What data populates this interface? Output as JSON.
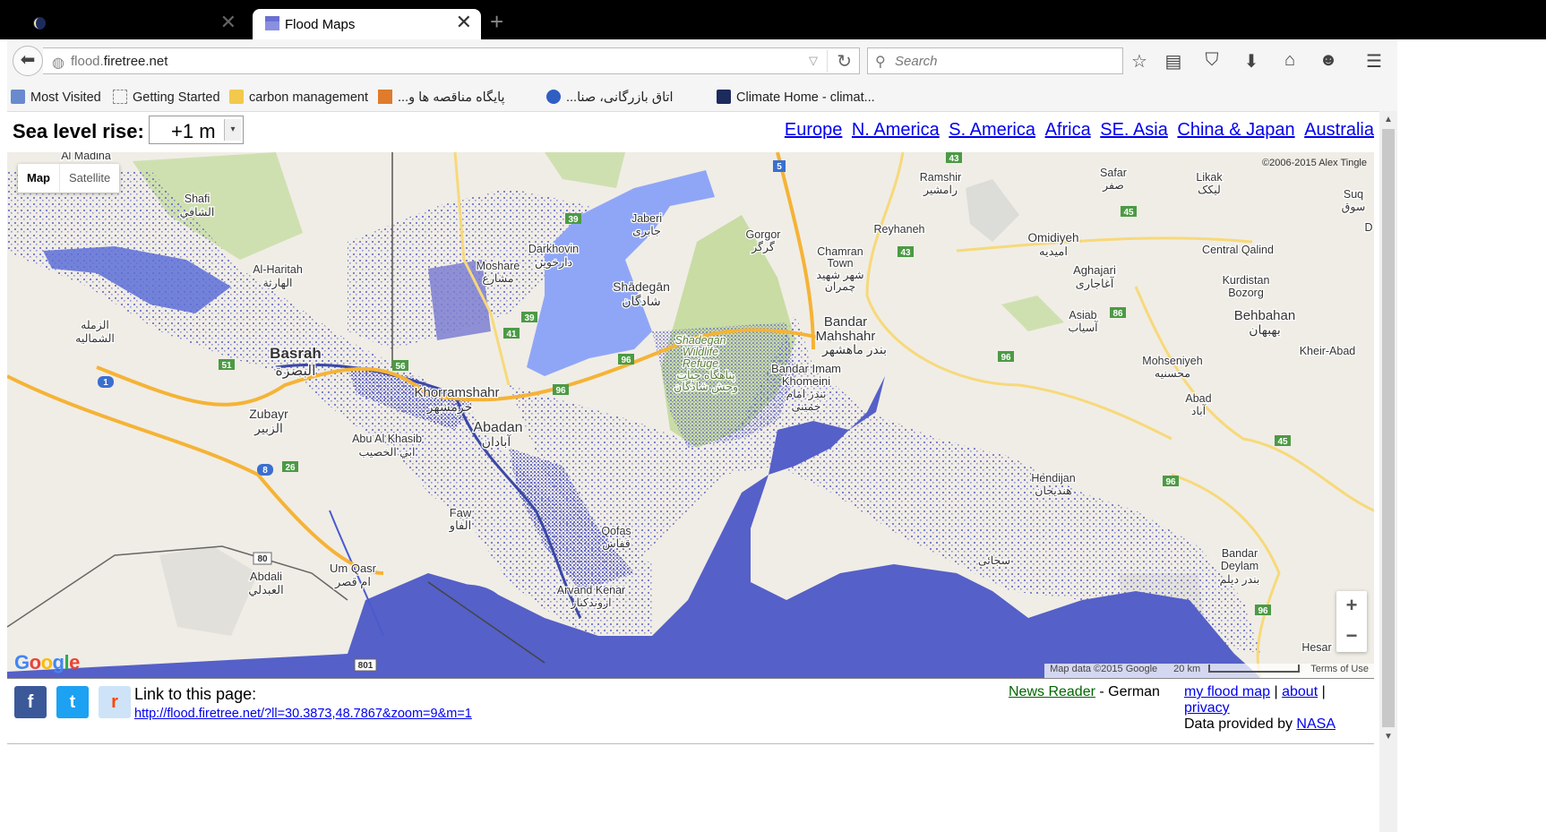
{
  "browser": {
    "tabs": [
      {
        "title": "",
        "active": false
      },
      {
        "title": "Flood Maps",
        "active": true
      }
    ],
    "url_host_prefix": "flood.",
    "url_host_main": "firetree.net",
    "search_placeholder": "Search",
    "bookmarks": [
      {
        "label": "Most Visited"
      },
      {
        "label": "Getting Started"
      },
      {
        "label": "carbon management"
      },
      {
        "label": "...پایگاه مناقصه ها و"
      },
      {
        "label": "...اتاق بازرگانی، صنا"
      },
      {
        "label": "Climate Home - climat..."
      }
    ]
  },
  "header": {
    "sea_level_label": "Sea level rise:",
    "sea_level_value": "+1 m",
    "regions": [
      "Europe",
      "N. America",
      "S. America",
      "Africa",
      "SE. Asia",
      "China & Japan",
      "Australia"
    ]
  },
  "map": {
    "type_buttons": {
      "map": "Map",
      "satellite": "Satellite"
    },
    "copyright": "©2006-2015 Alex Tingle",
    "map_data": "Map data ©2015 Google",
    "scale": "20 km",
    "terms": "Terms of Use",
    "google": "Google",
    "zoom_in": "+",
    "zoom_out": "−",
    "labels": {
      "al_madina": "Al Madina",
      "shafi": "Shafi",
      "shafi_ar": "الشافي",
      "al_haritah": "Al-Haritah",
      "al_haritah_ar": "الهارثة",
      "zubair_ar1": "الزمله",
      "zubair_ar2": "الشماليه",
      "basrah": "Basrah",
      "basrah_ar": "البصرة",
      "zubayr": "Zubayr",
      "zubayr_ar": "الزبير",
      "moshare": "Moshare",
      "moshare_ar": "مشارع",
      "darkhovin": "Darkhovin",
      "darkhovin_ar": "دارخوين",
      "jaberi": "Jaberi",
      "jaberi_ar": "جابری",
      "shadegan": "Shādegān",
      "shadegan_ar": "شادگان",
      "gorgor": "Gorgor",
      "gorgor_ar": "گرگر",
      "chamran": "Chamran",
      "chamran_town": "Town",
      "chamran_ar1": "شهر شهید",
      "chamran_ar2": "چمران",
      "reyhaneh": "Reyhaneh",
      "ramshir": "Ramshir",
      "ramshir_ar": "رامشیر",
      "bandar_mahshahr": "Bandar",
      "bandar_mahshahr2": "Mahshahr",
      "bandar_mahshahr_ar": "بندر ماهشهر",
      "refuge1": "Shadegan",
      "refuge2": "Wildlife",
      "refuge3": "Refuge",
      "refuge_ar": "پناهگاه حیات",
      "refuge_ar2": "وحش شادگان",
      "bik1": "Bandar Imam",
      "bik2": "Khomeini",
      "bik_ar1": "بندر امام",
      "bik_ar2": "خمینی",
      "khorramshahr": "Khorramshahr",
      "khorramshahr_ar": "خرمشهر",
      "abadan": "Abadan",
      "abadan_ar": "آبادان",
      "abu_al_khasib": "Abu Al Khasib",
      "abu_al_khasib_ar": "ابي الخصيب",
      "faw": "Faw",
      "faw_ar": "الفاو",
      "qofas": "Qofas",
      "qofas_ar": "قفاس",
      "arvand": "Arvand Kenar",
      "arvand_ar": "اروندکنار",
      "um_qasr": "Um Qasr",
      "um_qasr_ar": "ام قصر",
      "abdali": "Abdali",
      "abdali_ar": "العبدلي",
      "safar": "Safar",
      "safar_ar": "صفر",
      "likak": "Likak",
      "likak_ar": "لیکک",
      "suq": "Suq",
      "suq_ar": "سوق",
      "d_partial": "D",
      "omidiyeh": "Omidiyeh",
      "omidiyeh_ar": "امیدیه",
      "aghajari": "Aghajari",
      "aghajari_ar": "آغاجاری",
      "central_qalind": "Central Qalind",
      "kurdistan": "Kurdistan",
      "bozorg": "Bozorg",
      "behbahan": "Behbahan",
      "behbahan_ar": "بهبهان",
      "asiab": "Asiab",
      "asiab_ar": "آسیاب",
      "khier_abad": "Kheir-Abad",
      "mohseniyeh": "Mohseniyeh",
      "mohseniyeh_ar": "محسنیه",
      "abad": "Abad",
      "abad_ar": "آباد",
      "hendijan": "Hendijan",
      "hendijan_ar": "هندیجان",
      "sojaei": "سجائی",
      "deylam1": "Bandar",
      "deylam2": "Deylam",
      "deylam_ar": "بندر دیلم",
      "hesar": "Hesar"
    },
    "road_shields": {
      "r5": "5",
      "r43a": "43",
      "r43b": "43",
      "r39a": "39",
      "r39b": "39",
      "r41": "41",
      "r45a": "45",
      "r45b": "45",
      "r86": "86",
      "r96a": "96",
      "r96b": "96",
      "r96c": "96",
      "r96d": "96",
      "r96e": "96",
      "r51": "51",
      "r56": "56",
      "r1": "1",
      "r8": "8",
      "r26": "26",
      "r80": "80",
      "r801": "801"
    }
  },
  "footer": {
    "link_label": "Link to this page:",
    "link_url": "http://flood.firetree.net/?ll=30.3873,48.7867&zoom=9&m=1",
    "news_reader": "News Reader",
    "news_sep": " - ",
    "news_lang": "German",
    "my_flood_map": "my flood map",
    "sep": " | ",
    "about": "about",
    "privacy": "privacy",
    "data_provided": "Data provided by",
    "nasa": "NASA",
    "social": {
      "facebook": "f",
      "twitter": "t",
      "reddit": "r"
    }
  },
  "colors": {
    "flood_dark": "#5560c8",
    "flood_light": "#8fa6f7",
    "flood_dots": "#6a6fc9",
    "land": "#f0ede6",
    "park": "#c8dca4",
    "highway": "#f5b336",
    "road": "#f7d97a",
    "shield_green": "#4c9a45",
    "shield_blue": "#3a6fd0",
    "link": "#0000ee",
    "news_link": "#006600"
  }
}
